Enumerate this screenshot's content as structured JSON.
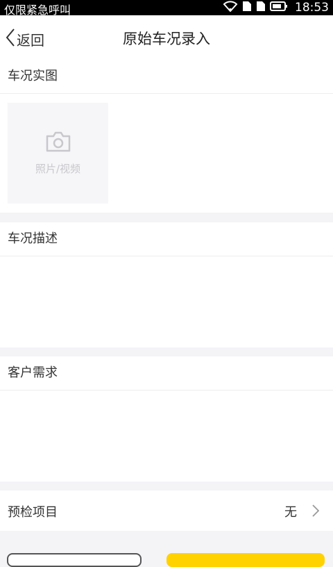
{
  "status_bar": {
    "carrier": "仅限紧急呼叫",
    "time": "18:53"
  },
  "nav": {
    "back_label": "返回",
    "title": "原始车况录入"
  },
  "photos": {
    "title": "车况实图",
    "add_label": "照片/视频"
  },
  "description": {
    "title": "车况描述",
    "value": ""
  },
  "customer_needs": {
    "title": "客户需求",
    "value": ""
  },
  "precheck": {
    "label": "预检项目",
    "value": "无"
  },
  "colors": {
    "accent": "#ffd200",
    "background": "#f4f3f6"
  }
}
